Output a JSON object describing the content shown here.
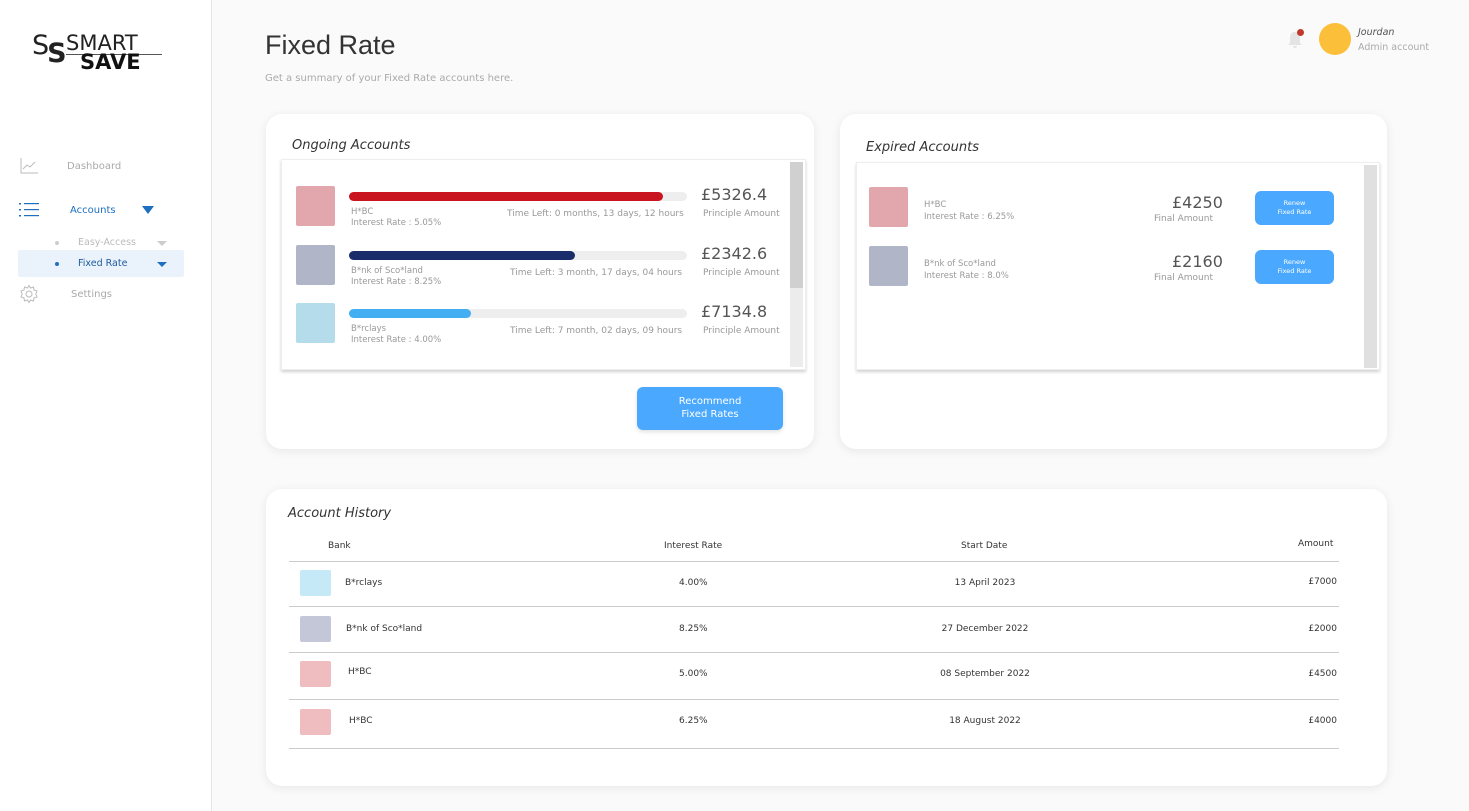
{
  "logo": {
    "mark": "SS",
    "line1": "SMART",
    "line2": "SAVE"
  },
  "sidebar": {
    "dashboard": "Dashboard",
    "accounts": "Accounts",
    "easy_access": "Easy-Access",
    "fixed_rate": "Fixed Rate",
    "settings": "Settings"
  },
  "header": {
    "title": "Fixed Rate",
    "subtitle": "Get a summary of your Fixed Rate accounts here.",
    "user_name": "Jourdan",
    "user_role": "Admin account"
  },
  "ongoing": {
    "title": "Ongoing Accounts",
    "items": [
      {
        "bank": "H*BC",
        "rate": "Interest Rate : 5.05%",
        "time_left": "Time Left: 0 months, 13 days, 12 hours",
        "amount": "£5326.4",
        "amount_label": "Principle Amount",
        "progress": 0.93,
        "color": "#c8151f",
        "swatch": "#e2a7ad"
      },
      {
        "bank": "B*nk of Sco*land",
        "rate": "Interest Rate : 8.25%",
        "time_left": "Time Left: 3 month, 17 days, 04 hours",
        "amount": "£2342.6",
        "amount_label": "Principle Amount",
        "progress": 0.67,
        "color": "#1a2d6b",
        "swatch": "#b0b5c7"
      },
      {
        "bank": "B*rclays",
        "rate": "Interest Rate : 4.00%",
        "time_left": "Time Left: 7 month, 02 days, 09 hours",
        "amount": "£7134.8",
        "amount_label": "Principle Amount",
        "progress": 0.36,
        "color": "#44aef3",
        "swatch": "#b4dcea"
      }
    ],
    "recommend_line1": "Recommend",
    "recommend_line2": "Fixed Rates"
  },
  "expired": {
    "title": "Expired Accounts",
    "items": [
      {
        "bank": "H*BC",
        "rate": "Interest Rate : 6.25%",
        "amount": "£4250",
        "amount_label": "Final Amount",
        "btn1": "Renew",
        "btn2": "Fixed Rate",
        "swatch": "#e2a7ad"
      },
      {
        "bank": "B*nk of Sco*land",
        "rate": "Interest Rate : 8.0%",
        "amount": "£2160",
        "amount_label": "Final Amount",
        "btn1": "Renew",
        "btn2": "Fixed Rate",
        "swatch": "#b0b5c7"
      }
    ]
  },
  "history": {
    "title": "Account History",
    "columns": {
      "bank": "Bank",
      "rate": "Interest Rate",
      "date": "Start Date",
      "amount": "Amount"
    },
    "rows": [
      {
        "bank": "B*rclays",
        "rate": "4.00%",
        "date": "13 April 2023",
        "amount": "£7000",
        "swatch": "#c6e9f8"
      },
      {
        "bank": "B*nk of Sco*land",
        "rate": "8.25%",
        "date": "27 December 2022",
        "amount": "£2000",
        "swatch": "#c4c7d8"
      },
      {
        "bank": "H*BC",
        "rate": "5.00%",
        "date": "08 September 2022",
        "amount": "£4500",
        "swatch": "#efbcc0"
      },
      {
        "bank": "H*BC",
        "rate": "6.25%",
        "date": "18 August 2022",
        "amount": "£4000",
        "swatch": "#efbcc0"
      }
    ]
  }
}
